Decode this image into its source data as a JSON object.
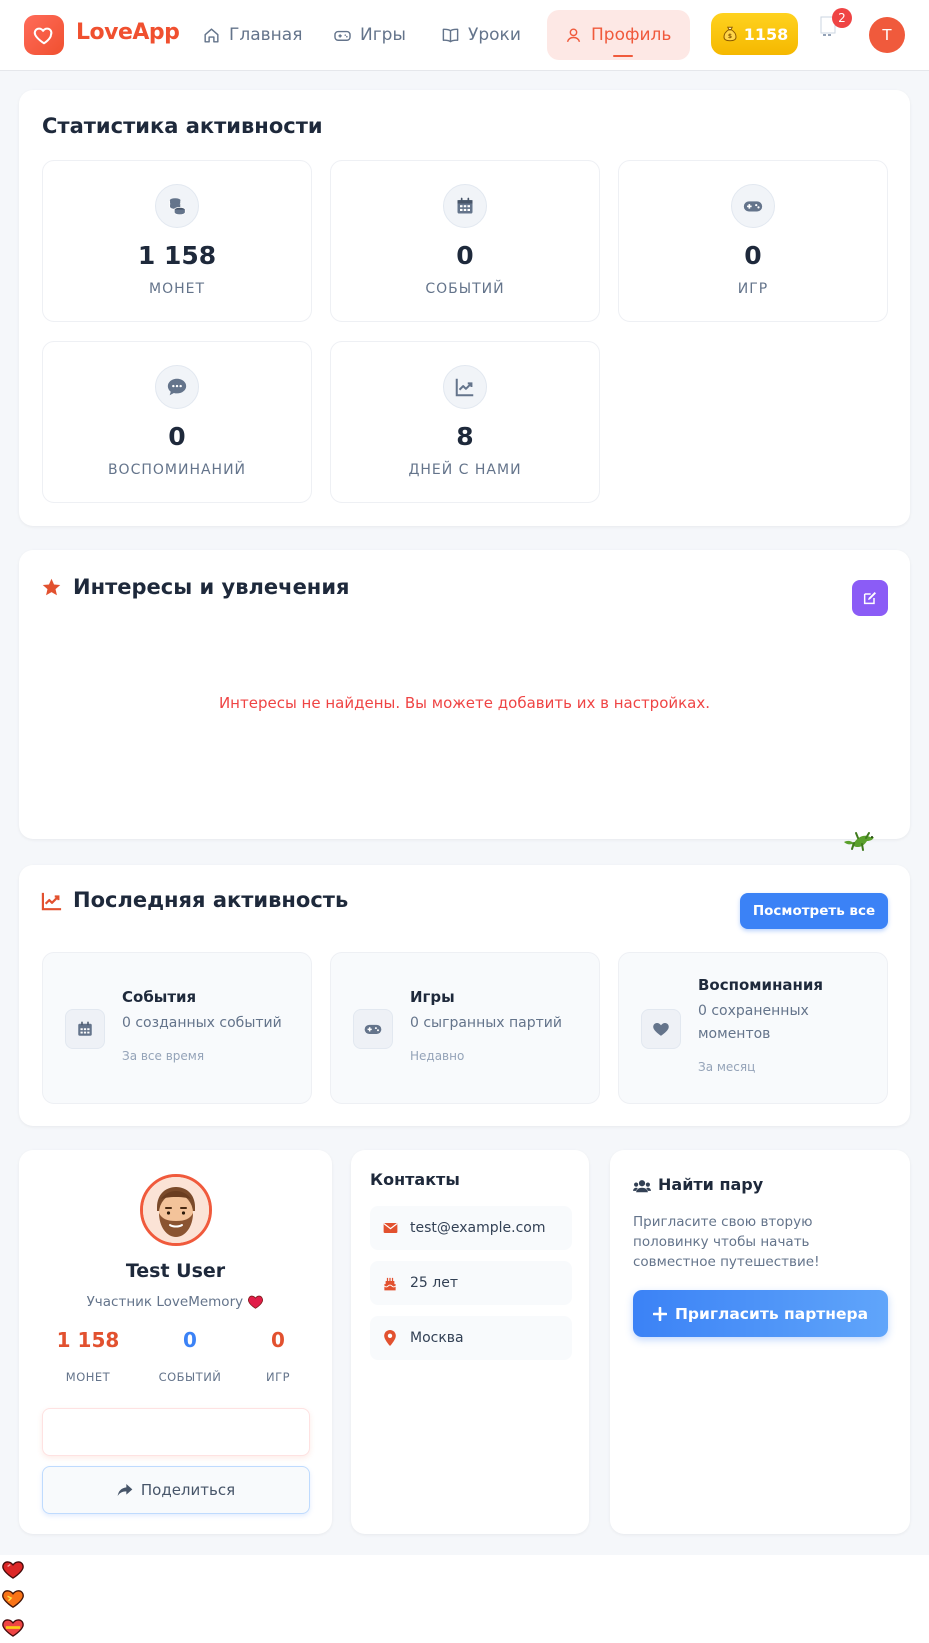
{
  "header": {
    "app_name": "LoveApp",
    "nav": [
      {
        "label": "Главная",
        "icon": "home-icon"
      },
      {
        "label": "Игры",
        "icon": "gamepad-icon"
      },
      {
        "label": "Уроки",
        "icon": "book-icon"
      },
      {
        "label": "Профиль",
        "icon": "user-icon",
        "active": true
      }
    ],
    "coins": "1158",
    "notifications_count": "2",
    "user_initial": "T"
  },
  "stats": {
    "title": "Статистика активности",
    "tiles": [
      {
        "value": "1 158",
        "label": "МОНЕТ",
        "icon": "coins-icon"
      },
      {
        "value": "0",
        "label": "СОБЫТИЙ",
        "icon": "calendar-icon"
      },
      {
        "value": "0",
        "label": "ИГР",
        "icon": "gamepad-icon"
      },
      {
        "value": "0",
        "label": "ВОСПОМИНАНИЙ",
        "icon": "chat-icon"
      },
      {
        "value": "8",
        "label": "ДНЕЙ С НАМИ",
        "icon": "chart-line-icon"
      }
    ]
  },
  "interests": {
    "title": "Интересы и увлечения",
    "empty_message": "Интересы не найдены. Вы можете добавить их в настройках."
  },
  "recent": {
    "title": "Последняя активность",
    "view_all": "Посмотреть все",
    "tiles": [
      {
        "title": "События",
        "desc": "0 созданных событий",
        "meta": "За все время",
        "icon": "calendar-icon"
      },
      {
        "title": "Игры",
        "desc": "0 сыгранных партий",
        "meta": "Недавно",
        "icon": "gamepad-icon"
      },
      {
        "title": "Воспоминания",
        "desc": "0 сохраненных моментов",
        "meta": "За месяц",
        "icon": "heart-icon"
      }
    ]
  },
  "profile": {
    "name": "Test User",
    "role": "Участник LoveMemory",
    "stats": [
      {
        "value": "1 158",
        "label": "МОНЕТ",
        "color": "#e2512f"
      },
      {
        "value": "0",
        "label": "СОБЫТИЙ",
        "color": "#3b82f6"
      },
      {
        "value": "0",
        "label": "ИГР",
        "color": "#e2512f"
      }
    ],
    "share_label": "Поделиться"
  },
  "contacts": {
    "title": "Контакты",
    "items": [
      {
        "value": "test@example.com",
        "icon": "envelope-icon"
      },
      {
        "value": "25 лет",
        "icon": "cake-icon"
      },
      {
        "value": "Москва",
        "icon": "map-pin-icon"
      }
    ]
  },
  "find_partner": {
    "title": "Найти пару",
    "text": "Пригласите свою вторую половинку чтобы начать совместное путешествие!",
    "button": "Пригласить партнера"
  },
  "colors": {
    "brand": "#f0502f",
    "accent_blue": "#3b82f6",
    "accent_purple": "#8b5cf6",
    "coin_gold": "#f5b800",
    "error": "#ef4444"
  }
}
